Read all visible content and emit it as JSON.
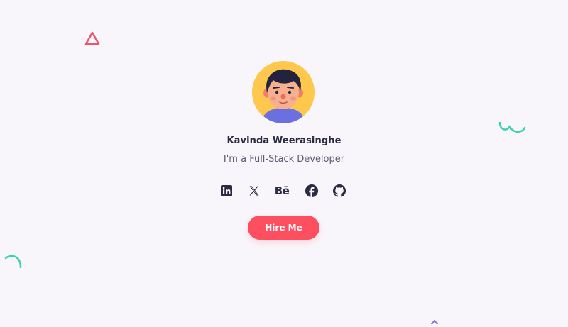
{
  "profile": {
    "name": "Kavinda Weerasinghe",
    "role": "I'm a Full-Stack Developer",
    "avatar_icon": "cartoon-boy-avatar",
    "avatar_bg": "#fdc84d"
  },
  "socials": [
    {
      "name": "linkedin",
      "icon": "linkedin-icon"
    },
    {
      "name": "x",
      "icon": "x-icon"
    },
    {
      "name": "behance",
      "icon": "behance-icon",
      "text": "Bē"
    },
    {
      "name": "facebook",
      "icon": "facebook-icon"
    },
    {
      "name": "github",
      "icon": "github-icon"
    }
  ],
  "cta": {
    "label": "Hire Me",
    "color": "#fd4f60"
  },
  "decorations": {
    "triangle_color": "#f0546a",
    "squiggle_color": "#3bd1b1",
    "arc_color": "#3bd1b1",
    "tick_color": "#7a72e6"
  },
  "theme": {
    "background": "#f9f6fb",
    "text_dark": "#2b2a43",
    "text_muted": "#5d5a72"
  }
}
